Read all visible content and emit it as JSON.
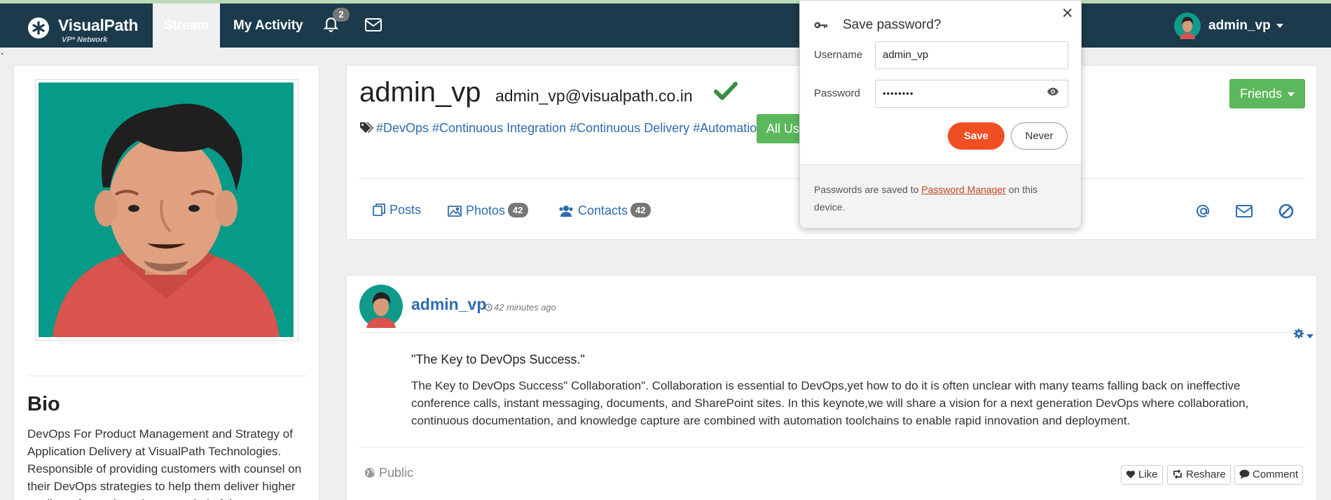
{
  "nav": {
    "brand_name": "VisualPath",
    "brand_sub": "VP* Network",
    "stream_label": "Stream",
    "activity_label": "My Activity",
    "notification_count": "2",
    "user_name": "admin_vp"
  },
  "bio": {
    "title": "Bio",
    "text": "DevOps For Product Management and Strategy of Application Delivery at VisualPath Technologies. Responsible of providing customers with counsel on their DevOps strategies to help them deliver higher quality software in a shorter period of time."
  },
  "profile": {
    "username": "admin_vp",
    "email": "admin_vp@visualpath.co.in",
    "tags": "#DevOps #Continuous Integration #Continuous Delivery #Automation",
    "all_users_label": "All Users",
    "friends_label": "Friends",
    "tabs": {
      "posts": "Posts",
      "photos": "Photos",
      "photos_count": "42",
      "contacts": "Contacts",
      "contacts_count": "42"
    }
  },
  "post": {
    "author": "admin_vp",
    "time": "42 minutes ago",
    "title": "\"The Key to DevOps Success.\"",
    "body": "The Key to DevOps Success\" Collaboration\". Collaboration is essential to DevOps,yet how to do it is often unclear with many teams falling back on ineffective conference calls, instant messaging, documents, and SharePoint sites. In this keynote,we will share a vision for a next generation DevOps where collaboration, continuous documentation, and knowledge capture are combined with automation toolchains to enable rapid innovation and deployment.",
    "visibility": "Public",
    "like_label": "Like",
    "reshare_label": "Reshare",
    "comment_label": "Comment"
  },
  "password_popup": {
    "title": "Save password?",
    "username_label": "Username",
    "username_value": "admin_vp",
    "password_label": "Password",
    "password_value": "••••••••",
    "save_label": "Save",
    "never_label": "Never",
    "footer_before": "Passwords are saved to ",
    "footer_link": "Password Manager",
    "footer_after": " on this device."
  },
  "colors": {
    "navbar": "#1b3a4b",
    "link": "#2e6cb0",
    "success": "#5cb85c",
    "save_button": "#f04e23"
  },
  "icons": [
    "star-logo-icon",
    "bell-icon",
    "envelope-icon",
    "caret-down-icon",
    "checkmark-icon",
    "tags-icon",
    "posts-icon",
    "photo-icon",
    "users-icon",
    "at-icon",
    "ban-icon",
    "clock-icon",
    "gear-icon",
    "globe-icon",
    "heart-icon",
    "retweet-icon",
    "comment-icon",
    "key-icon",
    "close-icon",
    "eye-icon"
  ]
}
